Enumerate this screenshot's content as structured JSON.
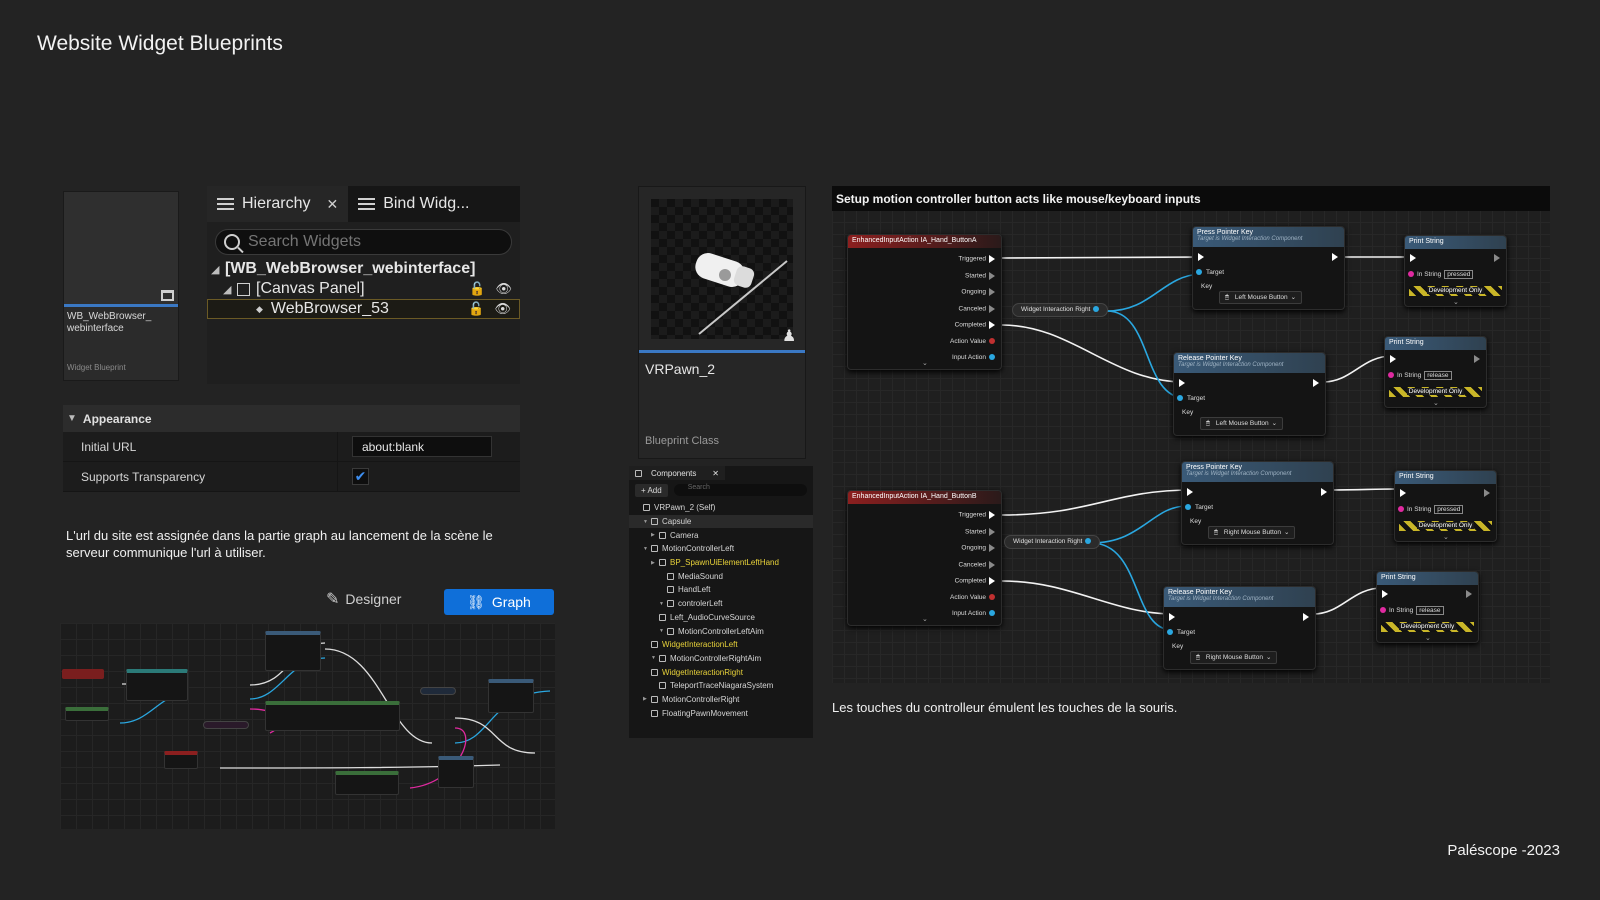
{
  "page": {
    "title": "Website Widget Blueprints",
    "credit": "Paléscope -2023"
  },
  "asset": {
    "name": "WB_WebBrowser_ webinterface",
    "type": "Widget Blueprint"
  },
  "hierarchy": {
    "tab_label": "Hierarchy",
    "bind_tab_label": "Bind Widg...",
    "search_placeholder": "Search Widgets",
    "rows": [
      "[WB_WebBrowser_webinterface]",
      "[Canvas Panel]",
      "WebBrowser_53"
    ]
  },
  "appearance": {
    "header": "Appearance",
    "initial_url_label": "Initial URL",
    "initial_url_value": "about:blank",
    "transparency_label": "Supports Transparency",
    "transparency_checked": true
  },
  "caption_left": "L'url du site est assignée dans la partie graph au lancement de la scène le serveur communique l'url à utiliser.",
  "modes": {
    "designer": "Designer",
    "graph": "Graph"
  },
  "pawn": {
    "name": "VRPawn_2",
    "type": "Blueprint Class"
  },
  "components": {
    "tab": "Components",
    "add": "+ Add",
    "search_placeholder": "Search",
    "items": [
      "VRPawn_2 (Self)",
      "Capsule",
      "Camera",
      "MotionControllerLeft",
      "BP_SpawnUiElementLeftHand",
      "MediaSound",
      "HandLeft",
      "controlerLeft",
      "Left_AudioCurveSource",
      "MotionControllerLeftAim",
      "WidgetInteractionLeft",
      "MotionControllerRightAim",
      "WidgetInteractionRight",
      "TeleportTraceNiagaraSystem",
      "MotionControllerRight",
      "FloatingPawnMovement"
    ]
  },
  "graph": {
    "header": "Setup motion controller button acts like mouse/keyboard inputs",
    "event_a": "EnhancedInputAction IA_Hand_ButtonA",
    "event_b": "EnhancedInputAction IA_Hand_ButtonB",
    "event_pins": [
      "Triggered",
      "Started",
      "Ongoing",
      "Canceled",
      "Completed",
      "Action Value",
      "Input Action"
    ],
    "getter": "Widget Interaction Right",
    "press": "Press Pointer Key",
    "release": "Release Pointer Key",
    "target_sub": "Target is Widget Interaction Component",
    "target": "Target",
    "key": "Key",
    "left_mouse": "Left Mouse Button",
    "right_mouse": "Right Mouse Button",
    "print": "Print String",
    "in_string": "In String",
    "pressed": "pressed",
    "released": "release",
    "dev_only": "Development Only"
  },
  "caption_right": "Les touches du controlleur émulent les touches de la souris."
}
